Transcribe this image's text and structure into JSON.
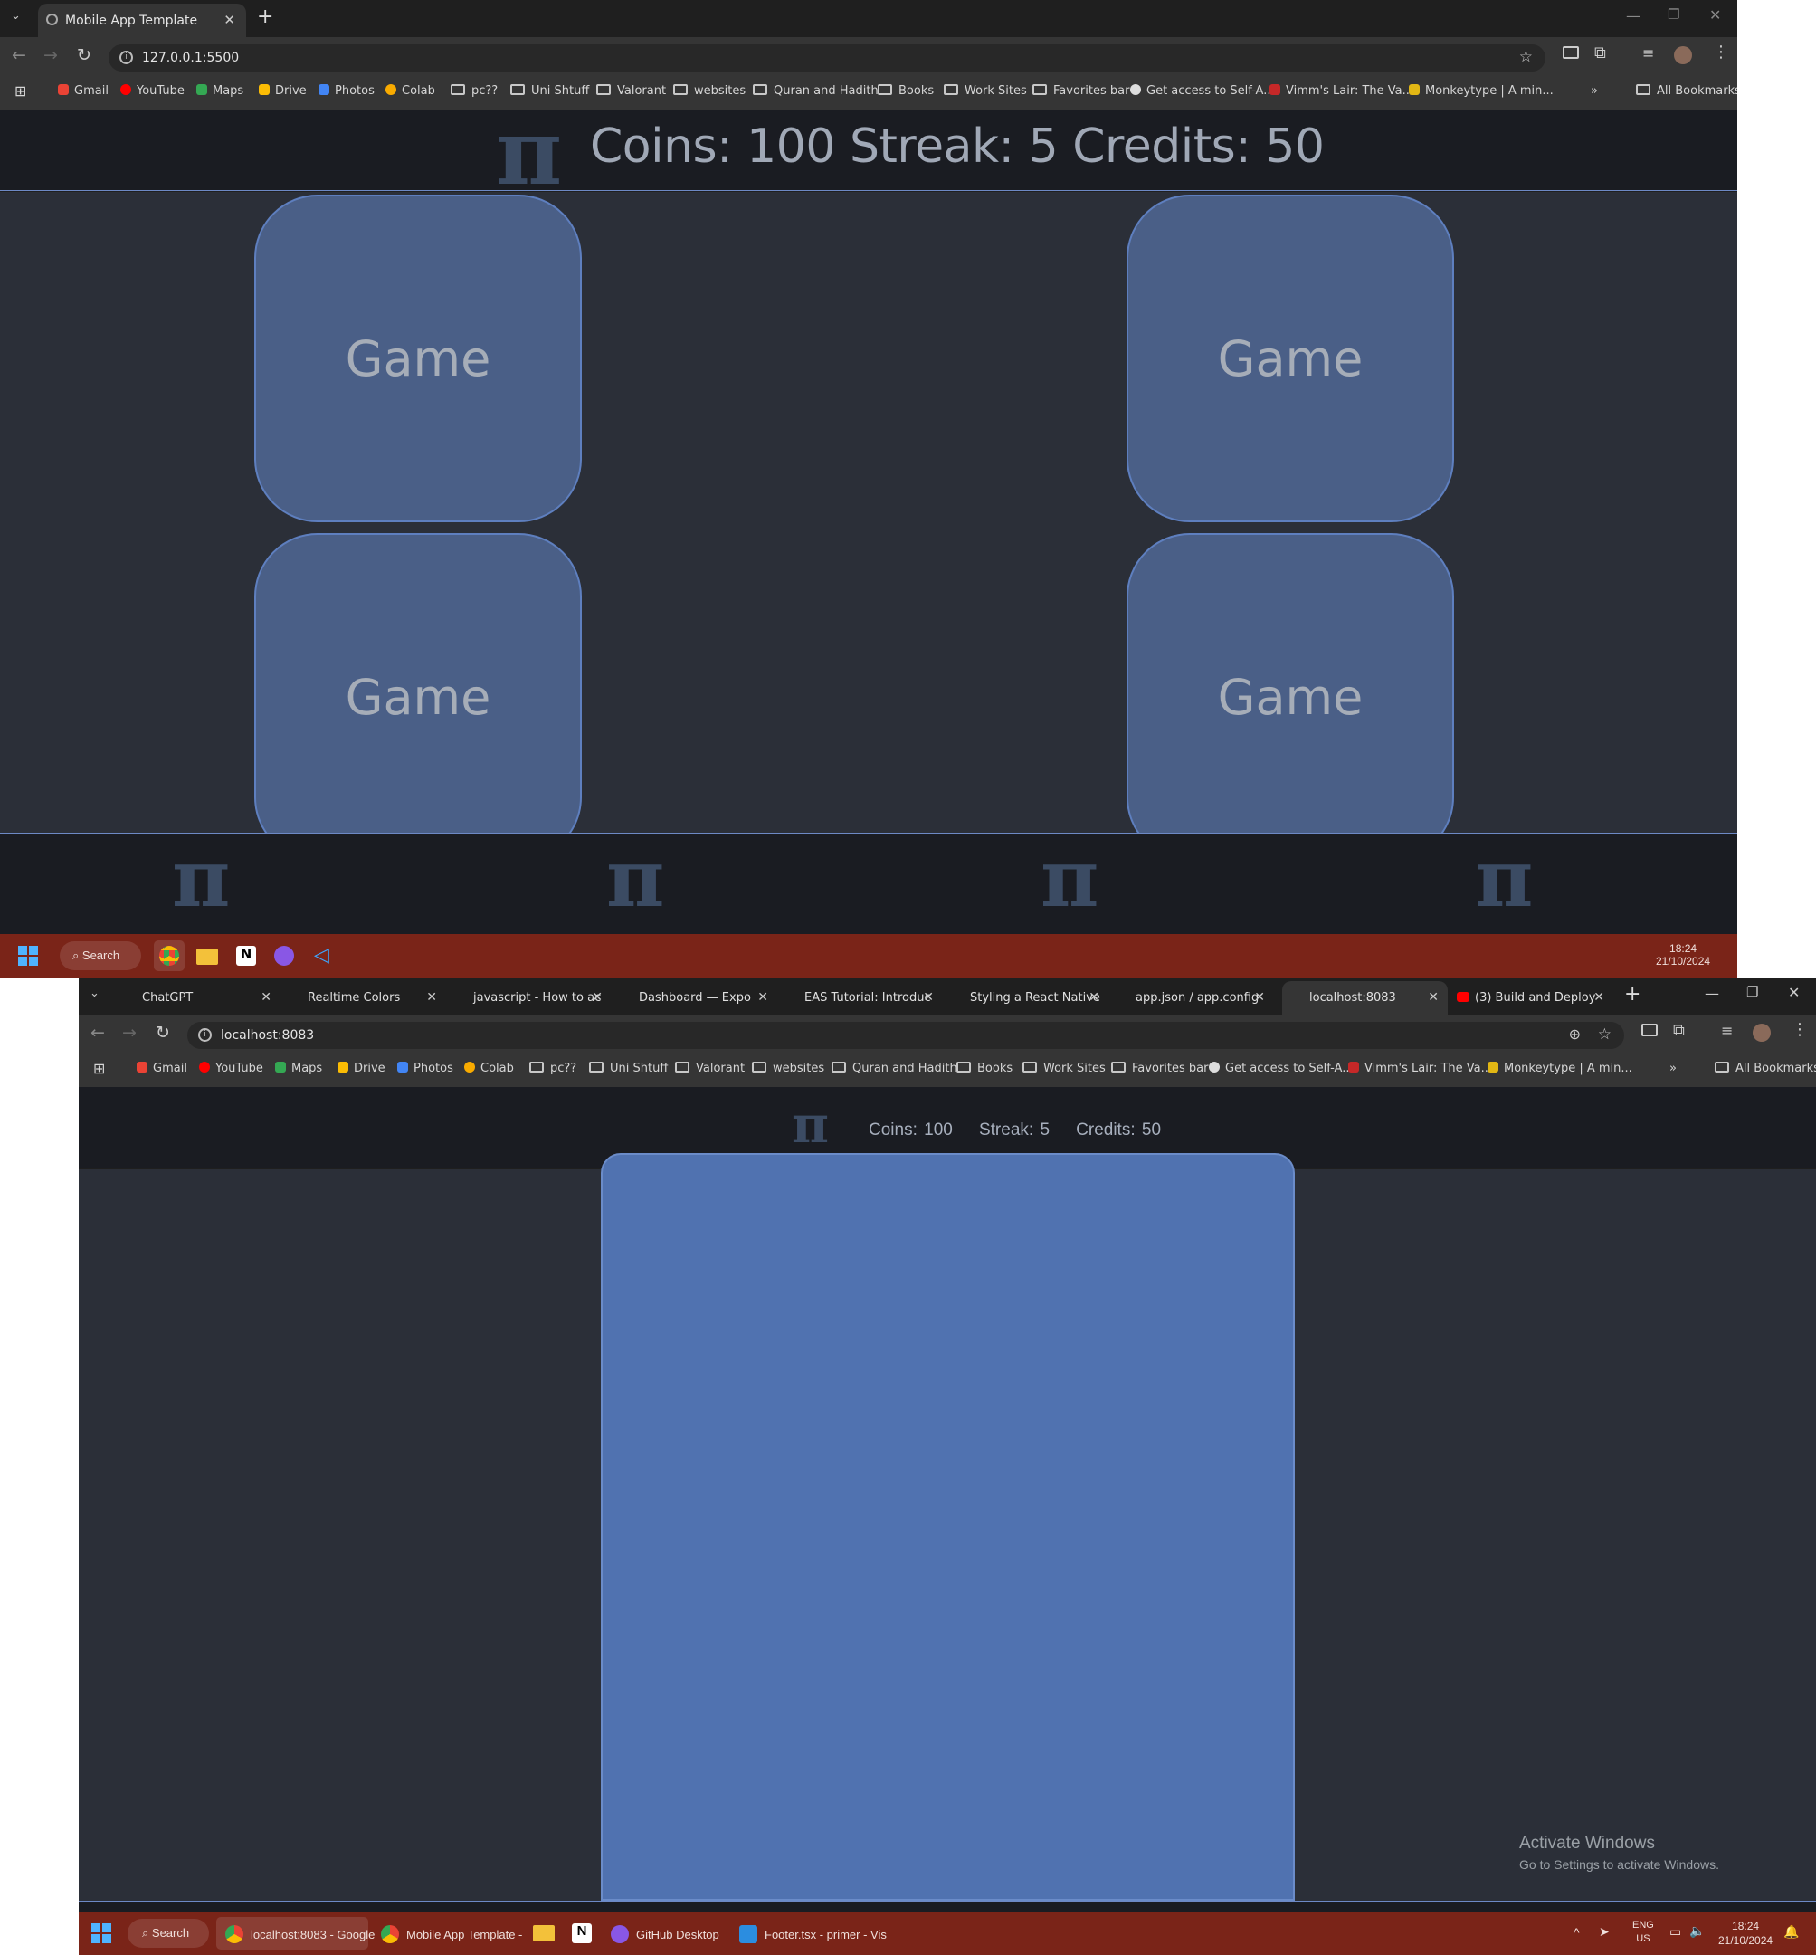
{
  "top_window": {
    "tab_title": "Mobile App Template",
    "url": "127.0.0.1:5500",
    "bookmarks": [
      "Gmail",
      "YouTube",
      "Maps",
      "Drive",
      "Photos",
      "Colab",
      "pc??",
      "Uni Shtuff",
      "Valorant",
      "websites",
      "Quran and Hadith",
      "Books",
      "Work Sites",
      "Favorites bar",
      "Get access to Self-A...",
      "Vimm's Lair: The Va...",
      "Monkeytype | A min..."
    ],
    "all_bookmarks": "All Bookmarks",
    "header": {
      "logo": "π",
      "stats": "Coins: 100 Streak: 5 Credits: 50"
    },
    "cards": [
      "Game",
      "Game",
      "Game",
      "Game"
    ],
    "footer_icons": [
      "pi-icon",
      "pi-icon",
      "pi-icon",
      "pi-icon"
    ],
    "taskbar": {
      "search": "Search",
      "time": "18:24",
      "date": "21/10/2024"
    }
  },
  "bottom_window": {
    "tabs": [
      {
        "title": "ChatGPT",
        "active": false
      },
      {
        "title": "Realtime Colors",
        "active": false
      },
      {
        "title": "javascript - How to ac",
        "active": false
      },
      {
        "title": "Dashboard — Expo",
        "active": false
      },
      {
        "title": "EAS Tutorial: Introduc",
        "active": false
      },
      {
        "title": "Styling a React Native",
        "active": false
      },
      {
        "title": "app.json / app.config",
        "active": false
      },
      {
        "title": "localhost:8083",
        "active": true
      },
      {
        "title": "(3) Build and Deploy",
        "active": false
      }
    ],
    "url": "localhost:8083",
    "bookmarks": [
      "Gmail",
      "YouTube",
      "Maps",
      "Drive",
      "Photos",
      "Colab",
      "pc??",
      "Uni Shtuff",
      "Valorant",
      "websites",
      "Quran and Hadith",
      "Books",
      "Work Sites",
      "Favorites bar",
      "Get access to Self-A...",
      "Vimm's Lair: The Va...",
      "Monkeytype | A min..."
    ],
    "all_bookmarks": "All Bookmarks",
    "header": {
      "logo": "π",
      "coins": "Coins: 100",
      "streak": "Streak: 5",
      "credits": "Credits: 50"
    },
    "activate": {
      "title": "Activate Windows",
      "subtitle": "Go to Settings to activate Windows."
    },
    "taskbar": {
      "search": "Search",
      "apps": [
        "localhost:8083 - Google",
        "Mobile App Template -",
        "GitHub Desktop",
        "Footer.tsx - primer - Vis"
      ],
      "lang": "ENG",
      "region": "US",
      "time": "18:24",
      "date": "21/10/2024"
    }
  },
  "colors": {
    "card": "#4a5f87",
    "bigcard": "#5072b0",
    "bg": "#2b2f38",
    "header": "#1a1c22",
    "taskbar": "#7a2418"
  }
}
